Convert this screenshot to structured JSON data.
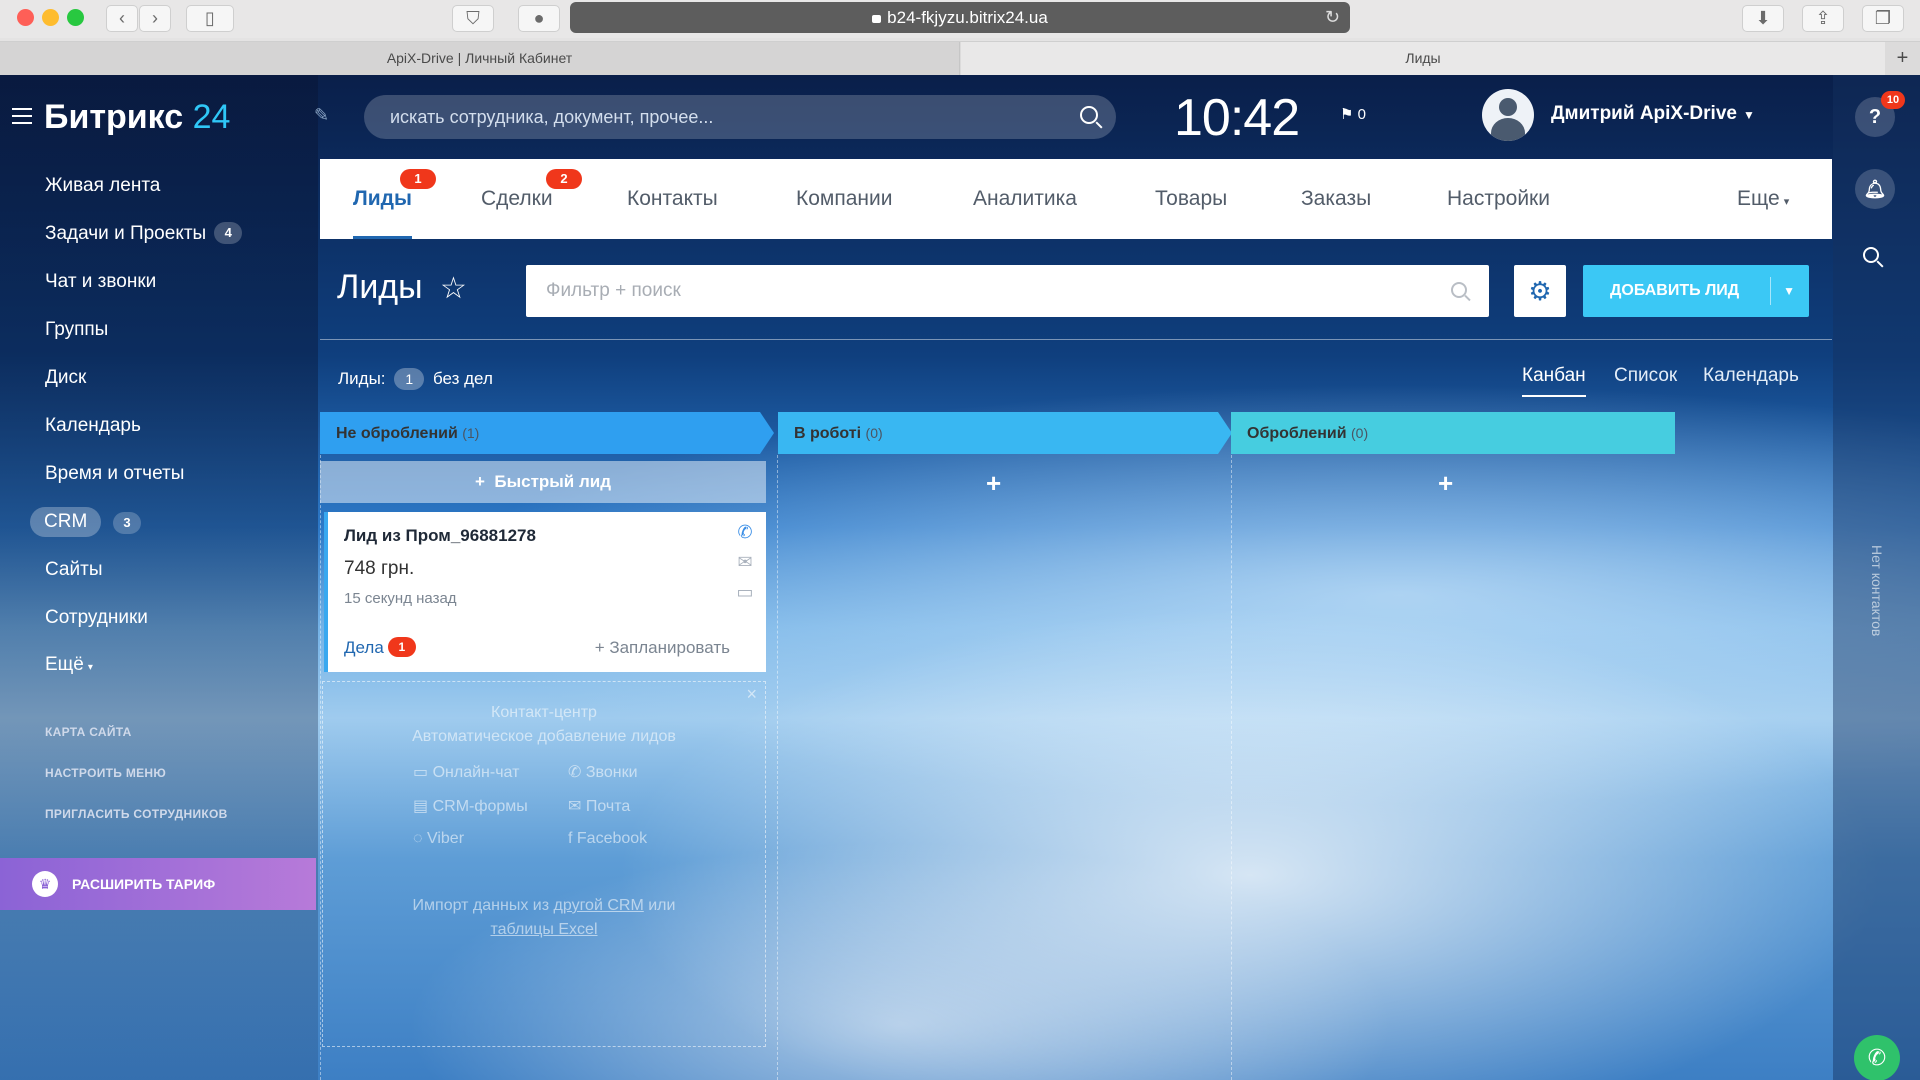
{
  "browser": {
    "url": "b24-fkjyzu.bitrix24.ua",
    "tabs": [
      {
        "label": "ApiX-Drive | Личный Кабинет"
      },
      {
        "label": "Лиды"
      }
    ],
    "new_tab": "+",
    "close_tab": "×"
  },
  "app": {
    "logo_text": "Битрикс",
    "logo_num": "24",
    "search_placeholder": "искать сотрудника, документ, прочее...",
    "clock": "10:42",
    "flag_count": "0",
    "user_name": "Дмитрий ApiX-Drive",
    "help_badge": "10",
    "no_contacts": "Нет контактов"
  },
  "menu": {
    "items": [
      {
        "label": "Живая лента"
      },
      {
        "label": "Задачи и Проекты",
        "count": "4"
      },
      {
        "label": "Чат и звонки"
      },
      {
        "label": "Группы"
      },
      {
        "label": "Диск"
      },
      {
        "label": "Календарь"
      },
      {
        "label": "Время и отчеты"
      },
      {
        "label": "CRM",
        "count": "3"
      },
      {
        "label": "Сайты"
      },
      {
        "label": "Сотрудники"
      },
      {
        "label": "Ещё"
      }
    ],
    "links": [
      "КАРТА САЙТА",
      "НАСТРОИТЬ МЕНЮ",
      "ПРИГЛАСИТЬ СОТРУДНИКОВ"
    ],
    "upgrade": "РАСШИРИТЬ ТАРИФ"
  },
  "crm_tabs": [
    {
      "label": "Лиды",
      "badge": "1"
    },
    {
      "label": "Сделки",
      "badge": "2"
    },
    {
      "label": "Контакты"
    },
    {
      "label": "Компании"
    },
    {
      "label": "Аналитика"
    },
    {
      "label": "Товары"
    },
    {
      "label": "Заказы"
    },
    {
      "label": "Настройки"
    },
    {
      "label": "Еще"
    }
  ],
  "page": {
    "title": "Лиды",
    "filter_placeholder": "Фильтр + поиск",
    "add_button": "ДОБАВИТЬ ЛИД",
    "summary_prefix": "Лиды:",
    "summary_count": "1",
    "summary_suffix": "без дел",
    "views": [
      "Канбан",
      "Список",
      "Календарь"
    ]
  },
  "kanban": {
    "columns": [
      {
        "name": "Не оброблений",
        "count": "(1)",
        "color": "#2f9ff0"
      },
      {
        "name": "В роботі",
        "count": "(0)",
        "color": "#39b7f2"
      },
      {
        "name": "Оброблений",
        "count": "(0)",
        "color": "#46cde0"
      }
    ],
    "quick_lead": "Быстрый лид",
    "card": {
      "title": "Лид из Пром_96881278",
      "price": "748 грн.",
      "time": "15 секунд назад",
      "deals_label": "Дела",
      "deals_badge": "1",
      "plan": "+ Запланировать"
    },
    "promo": {
      "title": "Контакт-центр",
      "subtitle": "Автоматическое добавление лидов",
      "options": [
        "Онлайн-чат",
        "Звонки",
        "CRM-формы",
        "Почта",
        "Viber",
        "Facebook"
      ],
      "import_prefix": "Импорт данных из",
      "import_link1": "другой CRM",
      "import_mid": "или",
      "import_link2": "таблицы Excel"
    }
  }
}
